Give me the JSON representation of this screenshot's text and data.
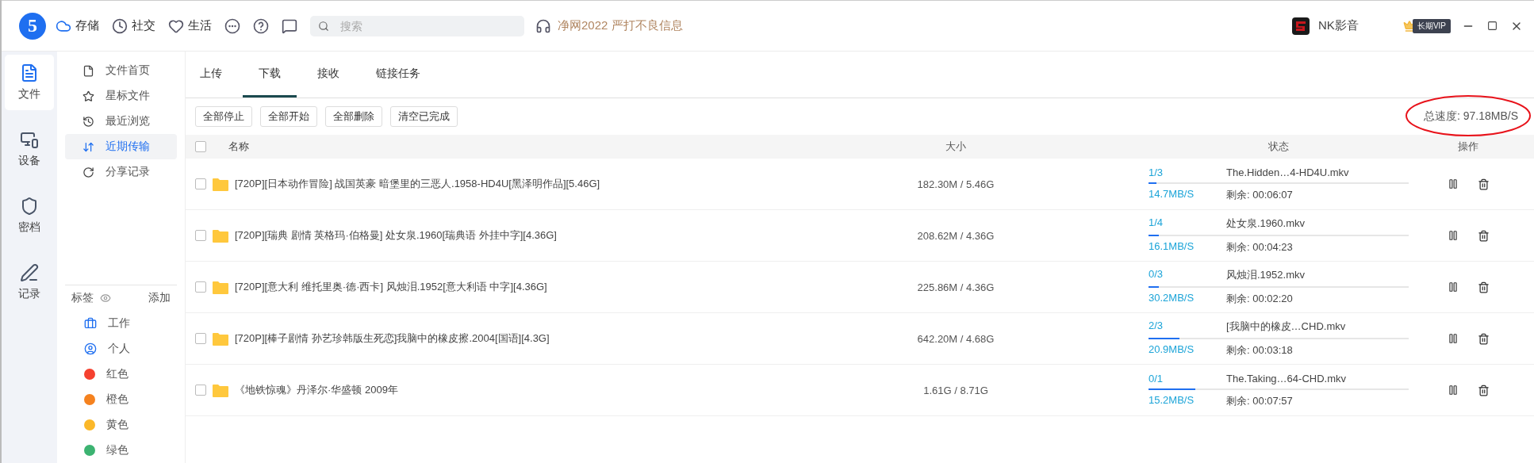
{
  "topbar": {
    "logo": "5",
    "nav": [
      {
        "label": "存储"
      },
      {
        "label": "社交"
      },
      {
        "label": "生活"
      }
    ],
    "search": {
      "placeholder": "搜索"
    },
    "notice": "净网2022 严打不良信息",
    "user": {
      "name": "NK影音"
    },
    "vip_badge": "长期VIP"
  },
  "rail": [
    {
      "label": "文件",
      "selected": true
    },
    {
      "label": "设备",
      "selected": false
    },
    {
      "label": "密档",
      "selected": false
    },
    {
      "label": "记录",
      "selected": false
    }
  ],
  "menu": [
    {
      "label": "文件首页",
      "selected": false
    },
    {
      "label": "星标文件",
      "selected": false
    },
    {
      "label": "最近浏览",
      "selected": false
    },
    {
      "label": "近期传输",
      "selected": true
    },
    {
      "label": "分享记录",
      "selected": false
    }
  ],
  "tags": {
    "title": "标签",
    "add": "添加",
    "items": [
      {
        "label": "工作",
        "kind": "icon"
      },
      {
        "label": "个人",
        "kind": "icon"
      },
      {
        "label": "红色",
        "kind": "dot",
        "color": "#f5412f"
      },
      {
        "label": "橙色",
        "kind": "dot",
        "color": "#f5821f"
      },
      {
        "label": "黄色",
        "kind": "dot",
        "color": "#fbb829"
      },
      {
        "label": "绿色",
        "kind": "dot",
        "color": "#3cb371"
      }
    ]
  },
  "tabs": [
    {
      "label": "上传",
      "selected": false
    },
    {
      "label": "下载",
      "selected": true
    },
    {
      "label": "接收",
      "selected": false
    },
    {
      "label": "链接任务",
      "selected": false
    }
  ],
  "actions": [
    "全部停止",
    "全部开始",
    "全部删除",
    "清空已完成"
  ],
  "total_speed": "总速度: 97.18MB/S",
  "table": {
    "columns": [
      "名称",
      "大小",
      "状态",
      "操作"
    ],
    "all_checked": false,
    "rows": [
      {
        "checked": false,
        "name": "[720P][日本动作冒险] 战国英豪 暗堡里的三恶人.1958-HD4U[黑泽明作品][5.46G]",
        "size": "182.30M / 5.46G",
        "parts": "1/3",
        "file": "The.Hidden…4-HD4U.mkv",
        "level": 0.03,
        "speed": "14.7MB/S",
        "remaining": "剩余: 00:06:07"
      },
      {
        "checked": false,
        "name": "[720P][瑞典 剧情 英格玛·伯格曼] 处女泉.1960[瑞典语 外挂中字][4.36G]",
        "size": "208.62M / 4.36G",
        "parts": "1/4",
        "file": "处女泉.1960.mkv",
        "level": 0.04,
        "speed": "16.1MB/S",
        "remaining": "剩余: 00:04:23"
      },
      {
        "checked": false,
        "name": "[720P][意大利 维托里奥·德·西卡] 风烛泪.1952[意大利语 中字][4.36G]",
        "size": "225.86M / 4.36G",
        "parts": "0/3",
        "file": "风烛泪.1952.mkv",
        "level": 0.04,
        "speed": "30.2MB/S",
        "remaining": "剩余: 00:02:20"
      },
      {
        "checked": false,
        "name": "[720P][棒子剧情 孙艺珍韩版生死恋]我脑中的橡皮擦.2004[国语][4.3G]",
        "size": "642.20M / 4.68G",
        "parts": "2/3",
        "file": "[我脑中的橡皮…CHD.mkv",
        "level": 0.12,
        "speed": "20.9MB/S",
        "remaining": "剩余: 00:03:18"
      },
      {
        "checked": false,
        "name": "《地铁惊魂》丹泽尔·华盛顿 2009年",
        "size": "1.61G / 8.71G",
        "parts": "0/1",
        "file": "The.Taking…64-CHD.mkv",
        "level": 0.18,
        "speed": "15.2MB/S",
        "remaining": "剩余: 00:07:57"
      }
    ]
  }
}
